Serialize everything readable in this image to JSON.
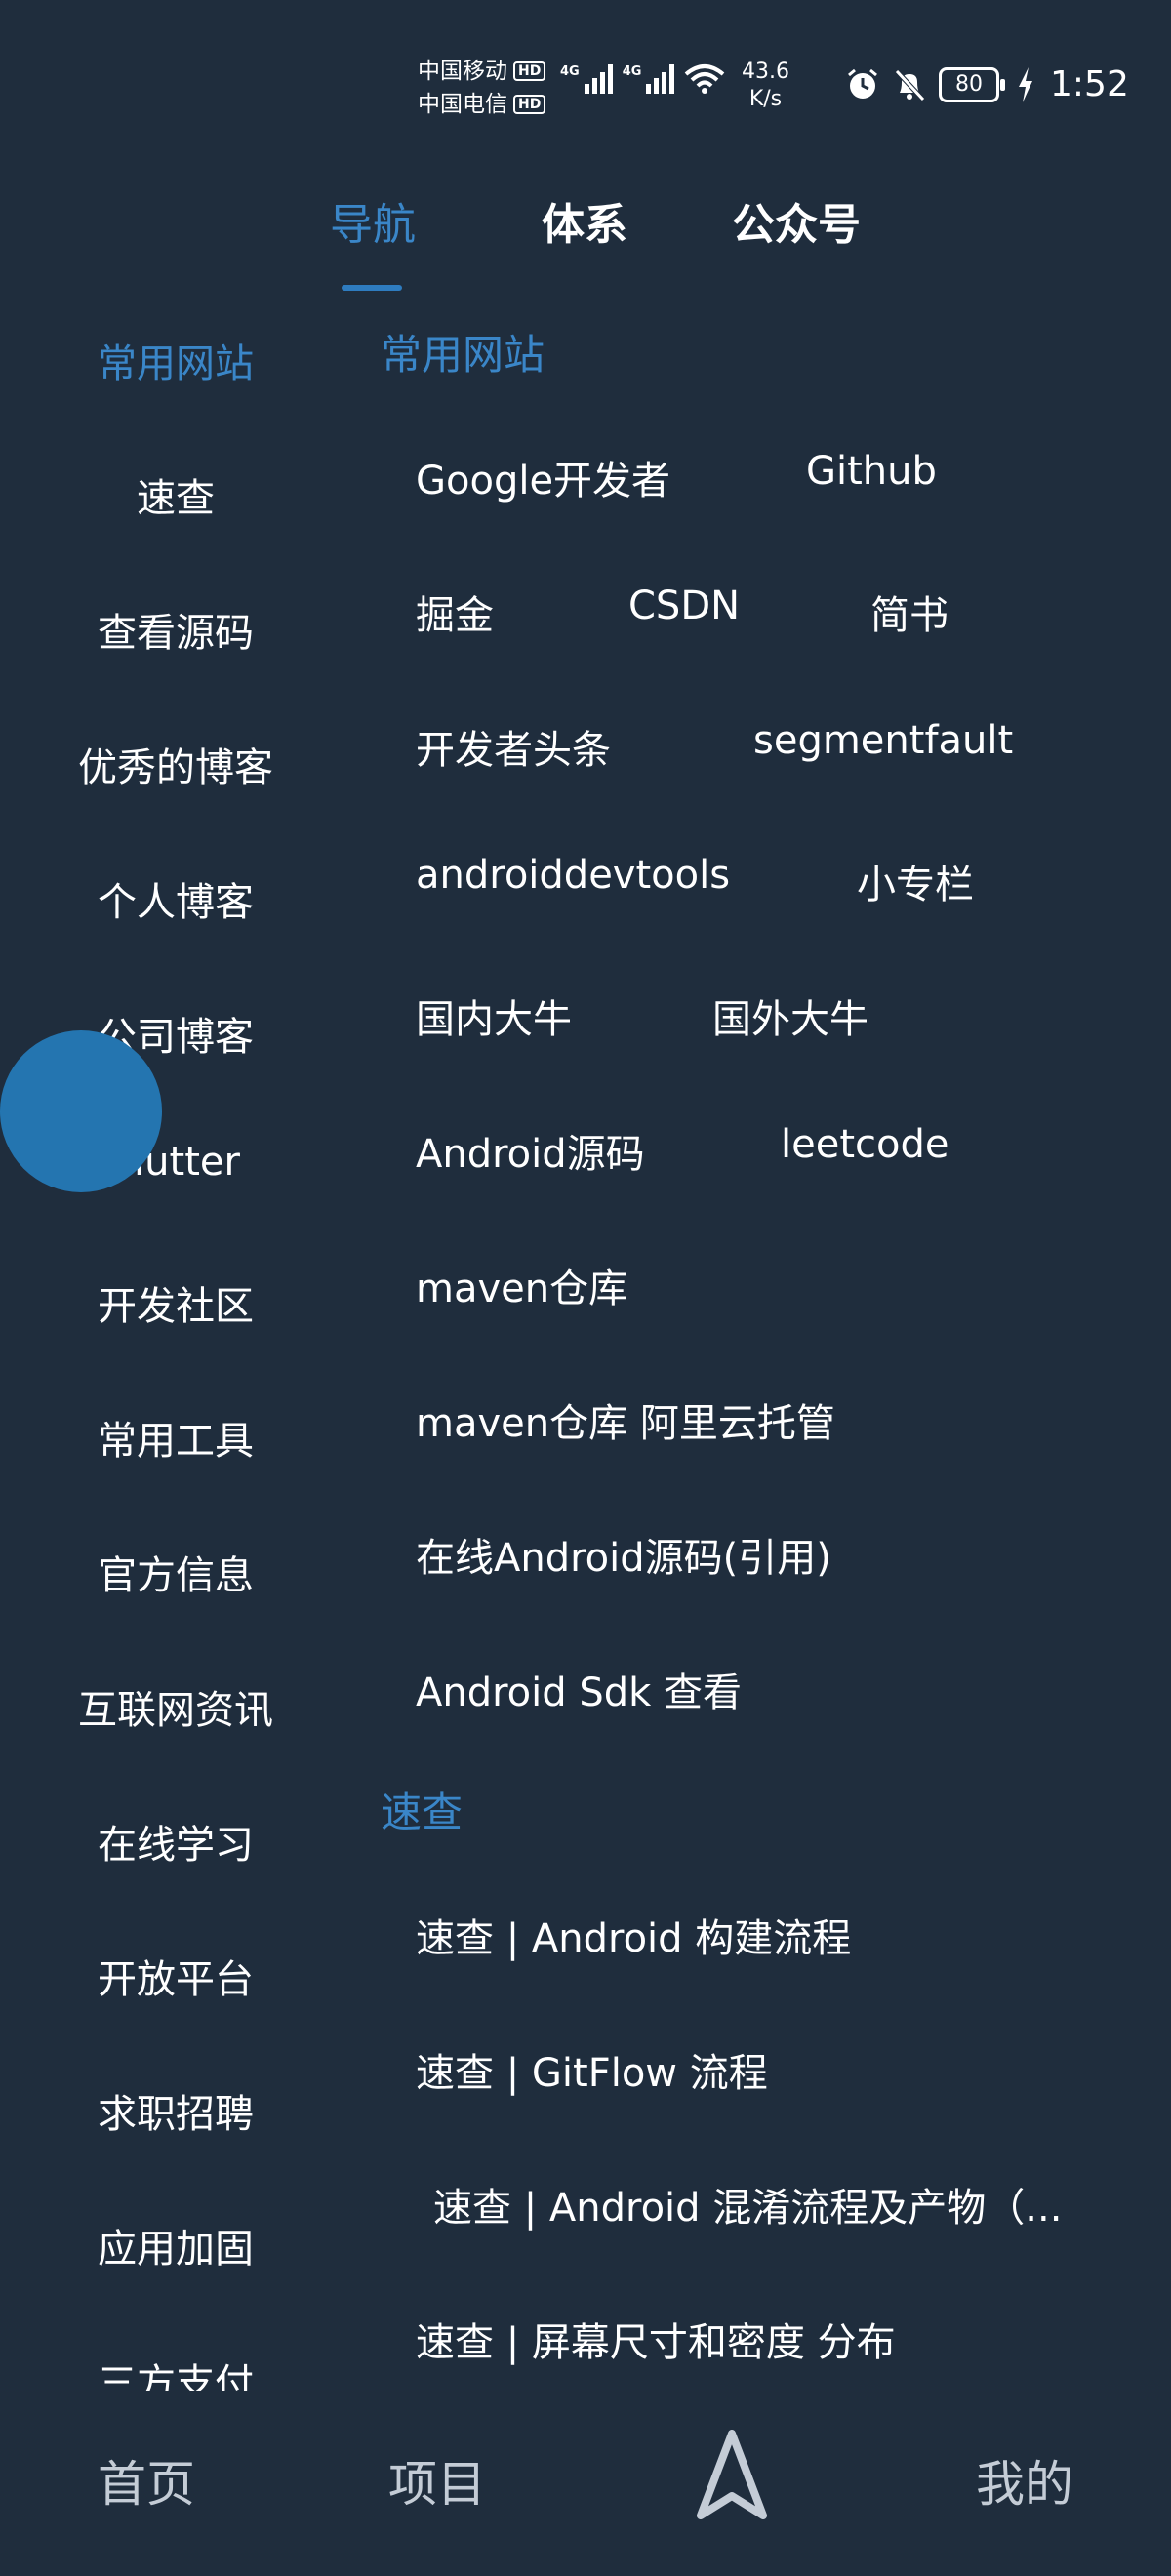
{
  "status_bar": {
    "carrier1": "中国移动",
    "carrier2": "中国电信",
    "hd": "HD",
    "net1": "4G",
    "net2": "4G",
    "speed_value": "43.6",
    "speed_unit": "K/s",
    "battery": "80",
    "time": "1:52"
  },
  "tabs": {
    "nav": "导航",
    "system": "体系",
    "wechat": "公众号"
  },
  "left_nav": {
    "items": [
      "常用网站",
      "速查",
      "查看源码",
      "优秀的博客",
      "个人博客",
      "公司博客",
      "Flutter",
      "开发社区",
      "常用工具",
      "官方信息",
      "互联网资讯",
      "在线学习",
      "开放平台",
      "求职招聘",
      "应用加固",
      "三方支付"
    ]
  },
  "sections": [
    {
      "title": "常用网站",
      "links": [
        "Google开发者",
        "Github",
        "掘金",
        "CSDN",
        "简书",
        "开发者头条",
        "segmentfault",
        "androiddevtools",
        "小专栏",
        "国内大牛",
        "国外大牛",
        "Android源码",
        "leetcode",
        "maven仓库",
        "maven仓库 阿里云托管",
        "在线Android源码(引用)",
        "Android Sdk 查看"
      ]
    },
    {
      "title": "速查",
      "links": [
        "速查 | Android 构建流程",
        "速查 | GitFlow 流程",
        "速查 | Android 混淆流程及产物（...",
        "速查 | 屏幕尺寸和密度 分布"
      ]
    }
  ],
  "bottom_nav": {
    "home": "首页",
    "project": "项目",
    "mine": "我的",
    "center_icon": "navigation-arrow-icon"
  },
  "colors": {
    "background": "#1f2d3d",
    "accent": "#3a86c8",
    "fab": "#2475b0"
  }
}
